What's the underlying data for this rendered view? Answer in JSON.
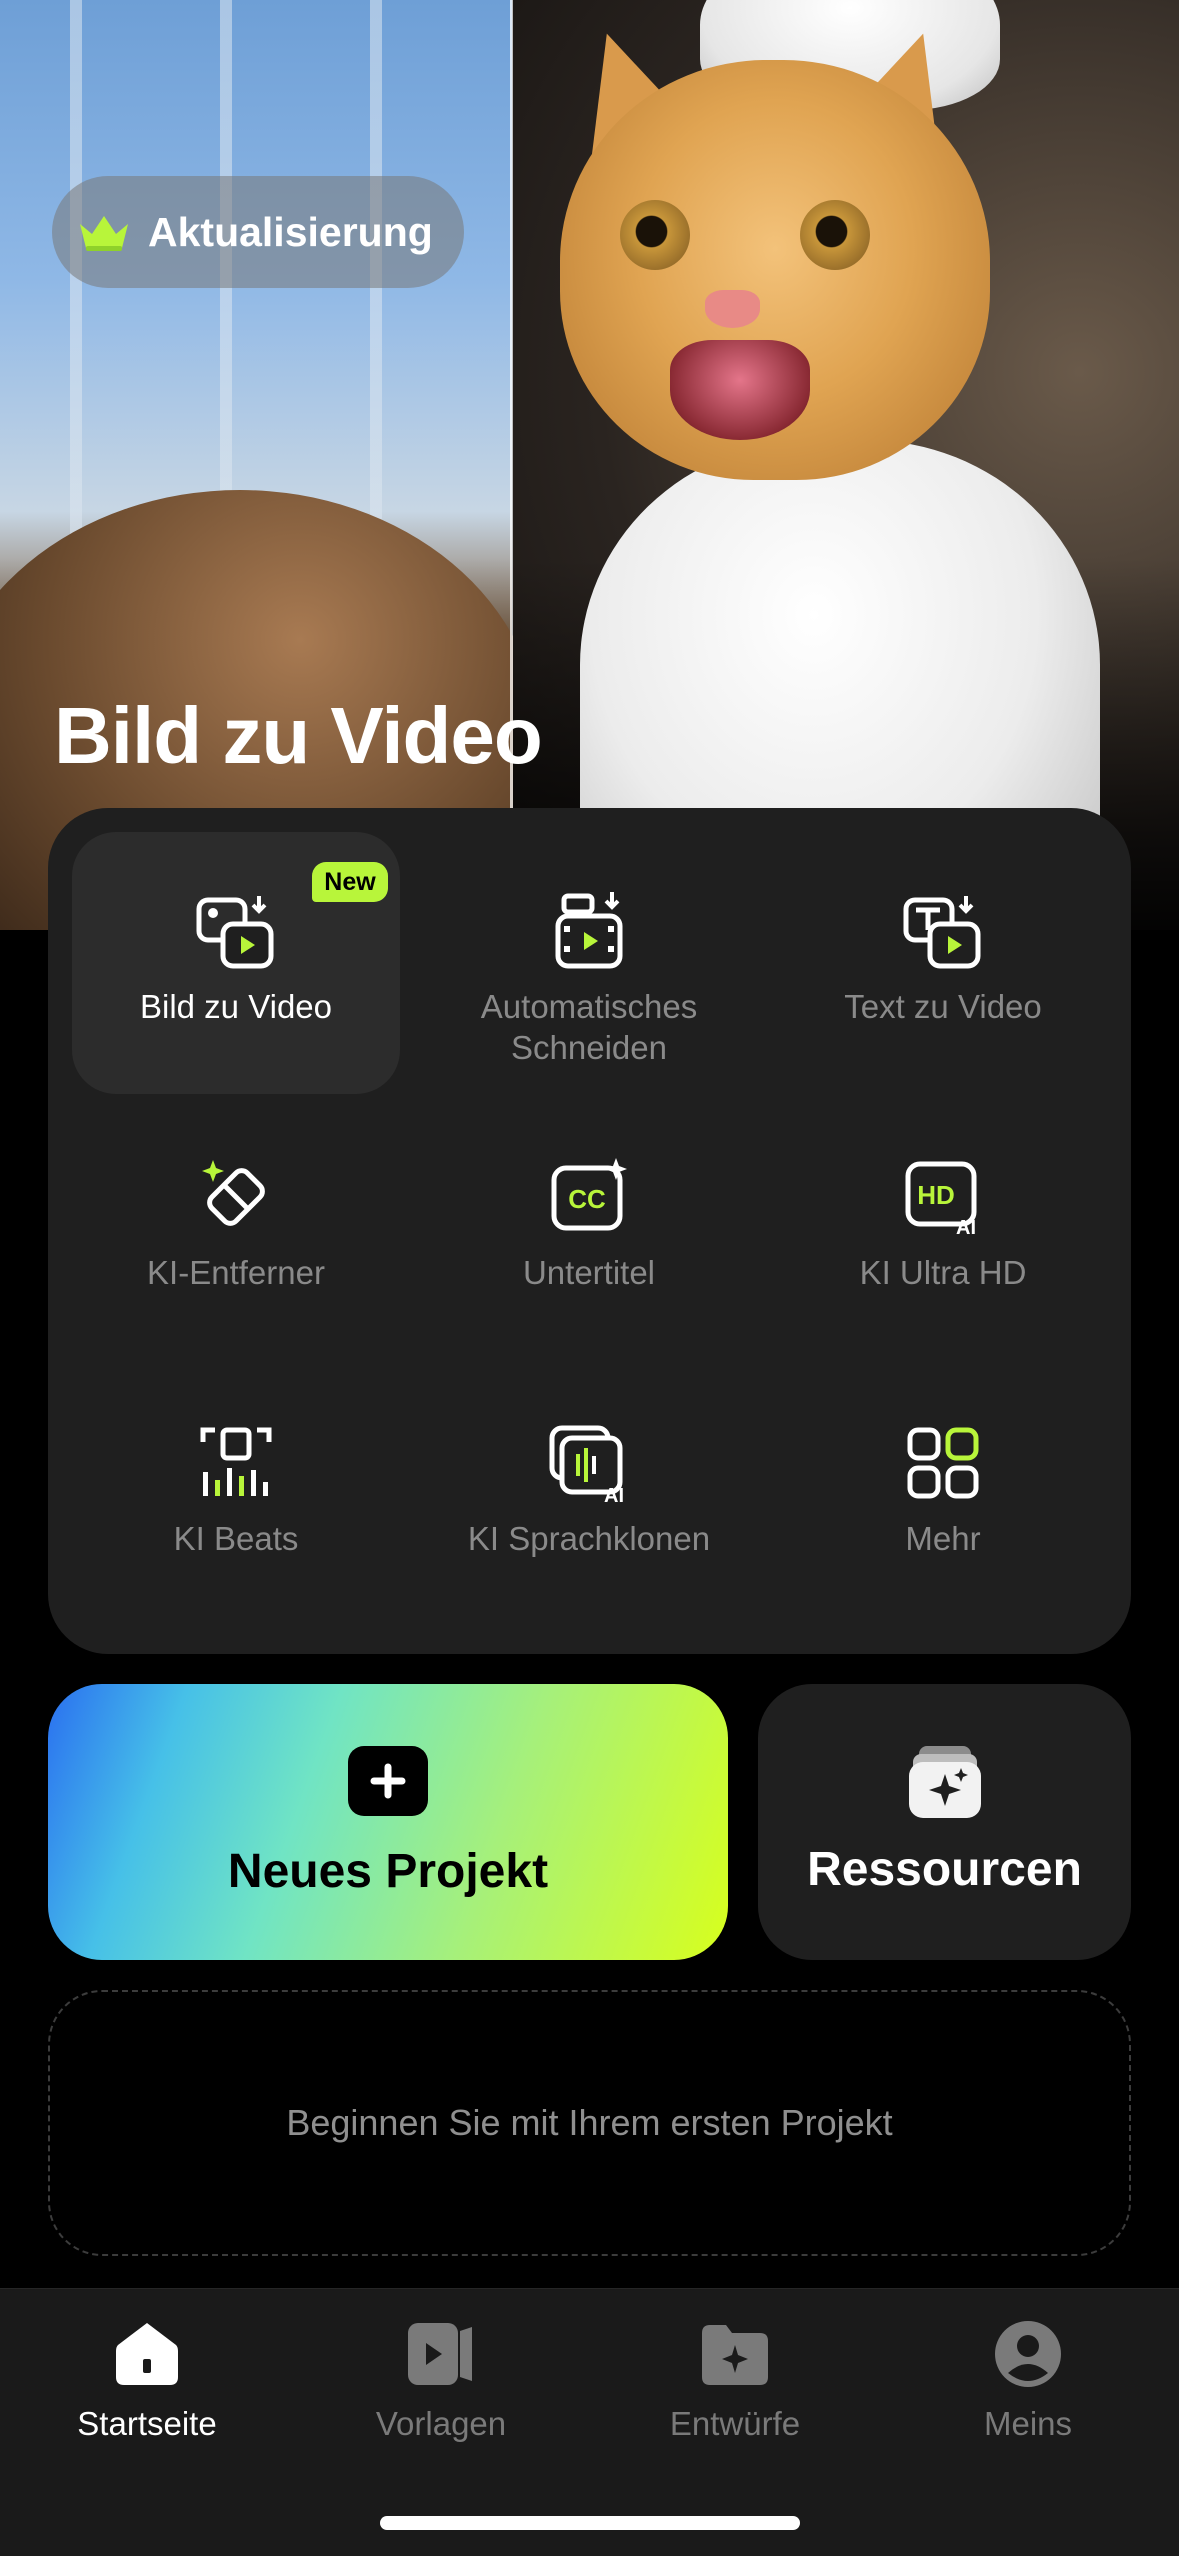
{
  "hero": {
    "upgrade_label": "Aktualisierung",
    "title": "Bild zu Video"
  },
  "tools": [
    {
      "label": "Bild zu Video",
      "icon": "image-to-video-icon",
      "badge": "New",
      "active": true
    },
    {
      "label": "Automatisches\nSchneiden",
      "icon": "auto-cut-icon"
    },
    {
      "label": "Text zu Video",
      "icon": "text-to-video-icon"
    },
    {
      "label": "KI-Entferner",
      "icon": "ai-remover-icon"
    },
    {
      "label": "Untertitel",
      "icon": "subtitles-icon"
    },
    {
      "label": "KI Ultra HD",
      "icon": "ultra-hd-icon"
    },
    {
      "label": "KI Beats",
      "icon": "beats-icon"
    },
    {
      "label": "KI Sprachklonen",
      "icon": "voice-clone-icon"
    },
    {
      "label": "Mehr",
      "icon": "more-grid-icon"
    }
  ],
  "actions": {
    "new_project_label": "Neues Projekt",
    "resources_label": "Ressourcen"
  },
  "empty_state": {
    "text": "Beginnen Sie mit Ihrem ersten Projekt"
  },
  "tabbar": {
    "items": [
      {
        "label": "Startseite",
        "icon": "home-icon",
        "active": true
      },
      {
        "label": "Vorlagen",
        "icon": "templates-icon"
      },
      {
        "label": "Entwürfe",
        "icon": "drafts-folder-icon"
      },
      {
        "label": "Meins",
        "icon": "profile-icon"
      }
    ]
  },
  "colors": {
    "accent_green": "#b8f53a",
    "card_bg": "#1f1f1f",
    "muted_text": "#8a8a8a"
  }
}
